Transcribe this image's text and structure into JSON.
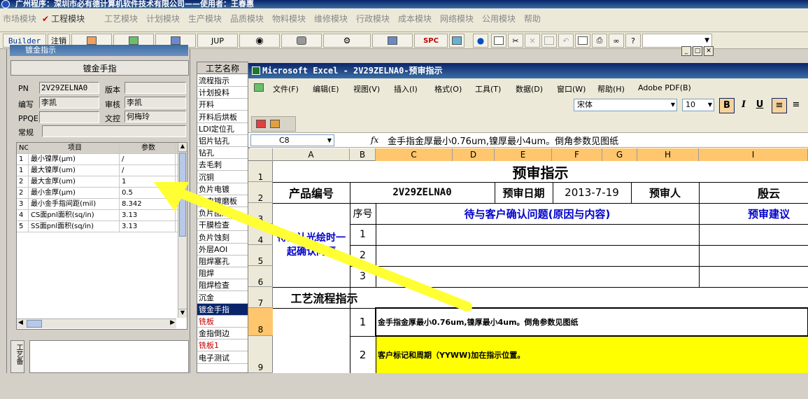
{
  "app": {
    "title": "广州程序：深圳市必有德计算机软件技术有限公司——使用者：王春惠"
  },
  "modules": {
    "items": [
      "市场模块",
      "工程模块",
      "工艺模块",
      "计划模块",
      "生产模块",
      "品质模块",
      "物料模块",
      "维修模块",
      "行政模块",
      "成本模块",
      "网络模块",
      "公用模块",
      "帮助"
    ],
    "active": "工程模块"
  },
  "toolbar": {
    "builder": "Builder",
    "logout": "注销",
    "jup": "JUP",
    "spc": "SPC"
  },
  "subwindow": {
    "title": "镀金指示"
  },
  "panel": {
    "heading": "镀金手指",
    "pn_label": "PN",
    "pn_value": "2V29ZELNA0",
    "version_label": "版本",
    "version_value": "",
    "editor_label": "编写",
    "editor_value": "李凯",
    "reviewer_label": "审核",
    "reviewer_value": "李凯",
    "ppqe_label": "PPQE",
    "ppqe_value": "",
    "doc_control_label": "文控",
    "doc_control_value": "何梅玲",
    "regular_label": "常规",
    "regular_value": "",
    "grid_headers": [
      "NO",
      "项目",
      "参数"
    ],
    "grid_rows": [
      {
        "no": "1",
        "item": "最小镍厚(μm)",
        "param": "/"
      },
      {
        "no": "1",
        "item": "最大镍厚(um)",
        "param": "/"
      },
      {
        "no": "2",
        "item": "最大金厚(um)",
        "param": "1"
      },
      {
        "no": "2",
        "item": "最小金厚(μm)",
        "param": "0.5"
      },
      {
        "no": "3",
        "item": "最小金手指间距(mil)",
        "param": "8.342"
      },
      {
        "no": "4",
        "item": "CS面pnl面积(sq/in)",
        "param": "3.13"
      },
      {
        "no": "5",
        "item": "SS面pnl面积(sq/in)",
        "param": "3.13"
      }
    ],
    "side_label": "工艺备"
  },
  "process": {
    "header": "工艺名称",
    "items": [
      "流程指示",
      "计划投料",
      "开料",
      "开料后烘板",
      "LDI定位孔",
      "铝片钻孔",
      "钻孔",
      "去毛刺",
      "沉铜",
      "负片电镀",
      "负电镀磨板",
      "负片图形",
      "干膜检查",
      "负片蚀刻",
      "外层AOI",
      "阻焊塞孔",
      "阻焊",
      "阻焊检查",
      "沉金",
      "镀金手指",
      "铣板",
      "金指倒边",
      "铣板1",
      "电子测试"
    ],
    "selected": "镀金手指",
    "red_items": [
      "铣板",
      "铣板1"
    ]
  },
  "excel": {
    "title": "Microsoft Excel - 2V29ZELNA0-预审指示",
    "menu": [
      "文件(F)",
      "编辑(E)",
      "视图(V)",
      "插入(I)",
      "格式(O)",
      "工具(T)",
      "数据(D)",
      "窗口(W)",
      "帮助(H)",
      "Adobe PDF(B)"
    ],
    "font_name": "宋体",
    "font_size": "10",
    "name_box": "C8",
    "formula": "金手指金厚最小0.76um,镍厚最小4um。倒角参数见图纸",
    "col_headers": [
      "A",
      "B",
      "C",
      "D",
      "E",
      "F",
      "G",
      "H",
      "I"
    ],
    "row_headers": [
      "1",
      "2",
      "3",
      "4",
      "5",
      "6",
      "7",
      "8",
      "9"
    ],
    "sheet": {
      "title": "预审指示",
      "product_no_label": "产品编号",
      "product_no": "2V29ZELNA0",
      "review_date_label": "预审日期",
      "review_date": "2013-7-19",
      "reviewer_label": "预审人",
      "reviewer": "殷云",
      "seq_label": "序号",
      "issue_label": "待与客户确认问题(原因与内容)",
      "suggest_label": "预审建议",
      "confirm_label": "待确认光绘时一起确认问题",
      "seq": [
        "1",
        "2",
        "3"
      ],
      "flow_label": "工艺流程指示",
      "flow_rows": [
        {
          "no": "1",
          "text": "金手指金厚最小0.76um,镍厚最小4um。倒角参数见图纸"
        },
        {
          "no": "2",
          "text": "客户标记和周期（YYWW)加在指示位置。"
        }
      ]
    }
  },
  "colors": {
    "highlight_yellow": "#ffff00",
    "arrow_yellow": "#ffff33",
    "header_orange": "#ffc66d",
    "blue_text": "#0000cc",
    "red_text": "#c00000"
  }
}
